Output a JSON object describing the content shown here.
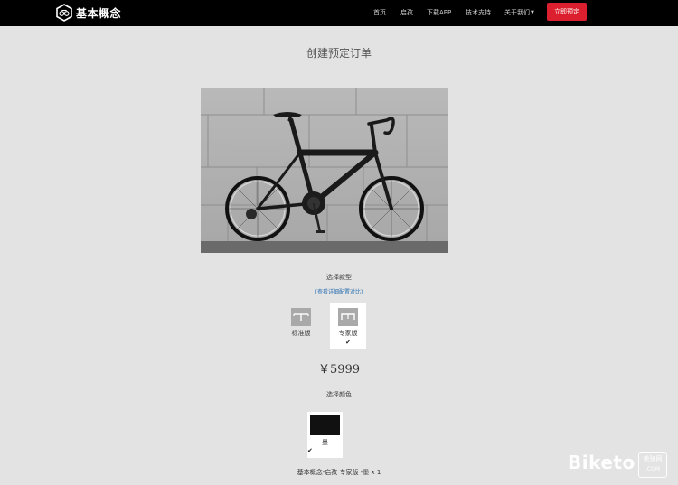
{
  "nav": {
    "brand": "基本概念",
    "items": [
      "首页",
      "启孜",
      "下载APP",
      "技术支持",
      "关于我们"
    ],
    "cta": "立即预定"
  },
  "page": {
    "title": "创建预定订单"
  },
  "model": {
    "label": "选择款型",
    "compare_link": "(查看详细配置对比)",
    "options": [
      {
        "label": "标准版",
        "selected": false
      },
      {
        "label": "专家版",
        "selected": true
      }
    ]
  },
  "price": "￥5999",
  "color": {
    "label": "选择颜色",
    "options": [
      {
        "label": "墨",
        "swatch": "#111111",
        "selected": true
      }
    ]
  },
  "summary": "基本概念-启孜 专家版 -墨 x 1",
  "watermark": {
    "brand": "Biketo",
    "sub1": "美骑网",
    "sub2": ".COM"
  },
  "colors": {
    "nav_bg": "#000000",
    "cta_bg": "#dc1f2e",
    "page_bg": "#e3e3e3",
    "link": "#2a6fb0"
  }
}
